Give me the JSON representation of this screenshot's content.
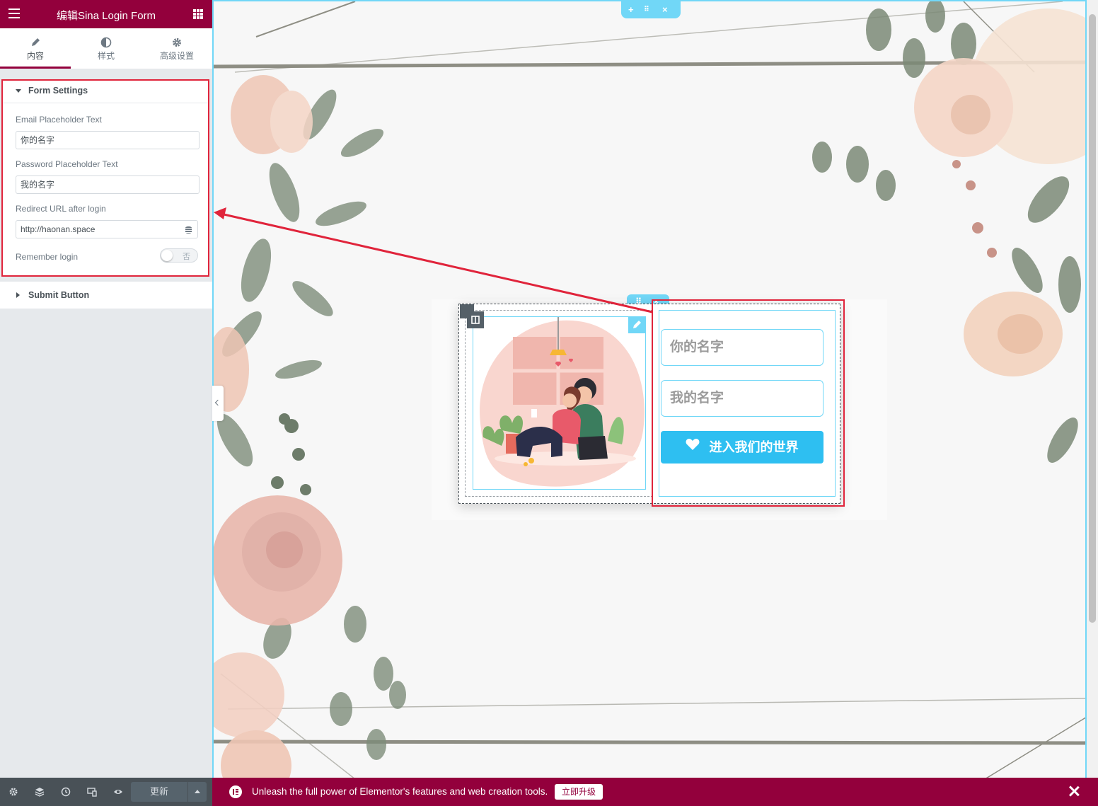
{
  "panel": {
    "title": "编辑Sina Login Form",
    "tabs": [
      {
        "label": "内容",
        "icon": "pencil-icon"
      },
      {
        "label": "样式",
        "icon": "half-circle-icon"
      },
      {
        "label": "高级设置",
        "icon": "gear-icon"
      }
    ],
    "form_settings": {
      "heading": "Form Settings",
      "email_label": "Email Placeholder Text",
      "email_value": "你的名字",
      "password_label": "Password Placeholder Text",
      "password_value": "我的名字",
      "redirect_label": "Redirect URL after login",
      "redirect_value": "http://haonan.space",
      "remember_label": "Remember login",
      "remember_value": "否"
    },
    "submit_section": {
      "heading": "Submit Button"
    },
    "footer": {
      "update_label": "更新"
    }
  },
  "canvas": {
    "login_form": {
      "email_placeholder": "你的名字",
      "password_placeholder": "我的名字",
      "submit_label": "进入我们的世界"
    }
  },
  "promo": {
    "message": "Unleash the full power of Elementor's features and web creation tools.",
    "button_label": "立即升级"
  },
  "colors": {
    "brand": "#93003c",
    "editor_accent": "#71d7f7",
    "submit_button": "#2ebff1",
    "annotation": "#e0243b"
  }
}
